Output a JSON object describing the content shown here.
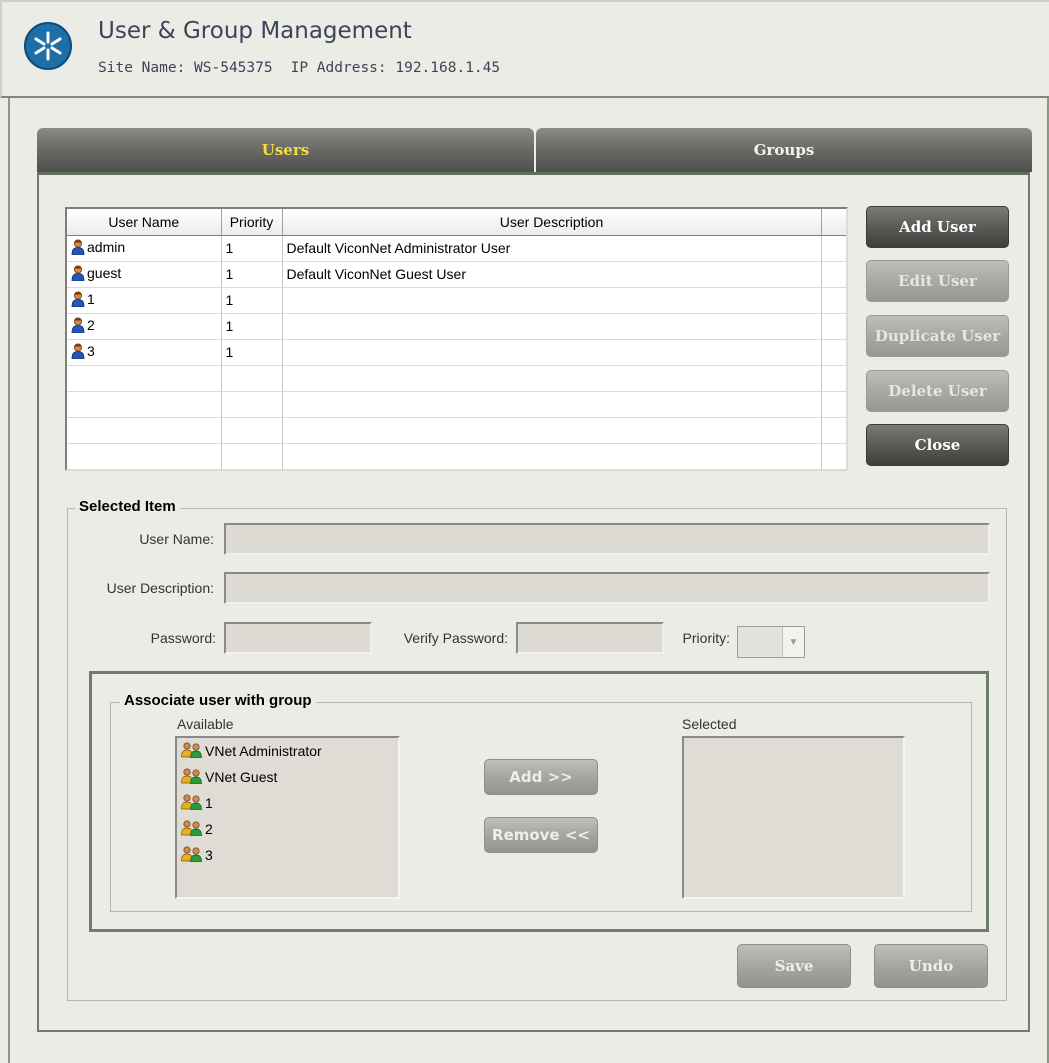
{
  "header": {
    "title": "User & Group Management",
    "site_name": "Site Name: WS-545375",
    "ip_address": "IP Address: 192.168.1.45"
  },
  "tabs": [
    {
      "label": "Users",
      "active": true
    },
    {
      "label": "Groups",
      "active": false
    }
  ],
  "users_table": {
    "columns": [
      "User Name",
      "Priority",
      "User Description"
    ],
    "rows": [
      {
        "name": "admin",
        "priority": "1",
        "description": "Default ViconNet Administrator User"
      },
      {
        "name": "guest",
        "priority": "1",
        "description": "Default ViconNet Guest User"
      },
      {
        "name": "1",
        "priority": "1",
        "description": ""
      },
      {
        "name": "2",
        "priority": "1",
        "description": ""
      },
      {
        "name": "3",
        "priority": "1",
        "description": ""
      }
    ]
  },
  "actions": {
    "add_user": "Add User",
    "edit_user": "Edit User",
    "duplicate_user": "Duplicate User",
    "delete_user": "Delete User",
    "close": "Close"
  },
  "selected_item": {
    "legend": "Selected Item",
    "user_name_label": "User Name:",
    "user_description_label": "User Description:",
    "password_label": "Password:",
    "verify_password_label": "Verify Password:",
    "priority_label": "Priority:"
  },
  "associate": {
    "legend": "Associate user with group",
    "available_label": "Available",
    "selected_label": "Selected",
    "available_groups": [
      "VNet Administrator",
      "VNet Guest",
      "1",
      "2",
      "3"
    ],
    "add_label": "Add >>",
    "remove_label": "Remove <<"
  },
  "footer": {
    "save": "Save",
    "undo": "Undo"
  },
  "colors": {
    "active_tab_text": "#f0df3c",
    "frame_green": "#6d7d6a"
  }
}
